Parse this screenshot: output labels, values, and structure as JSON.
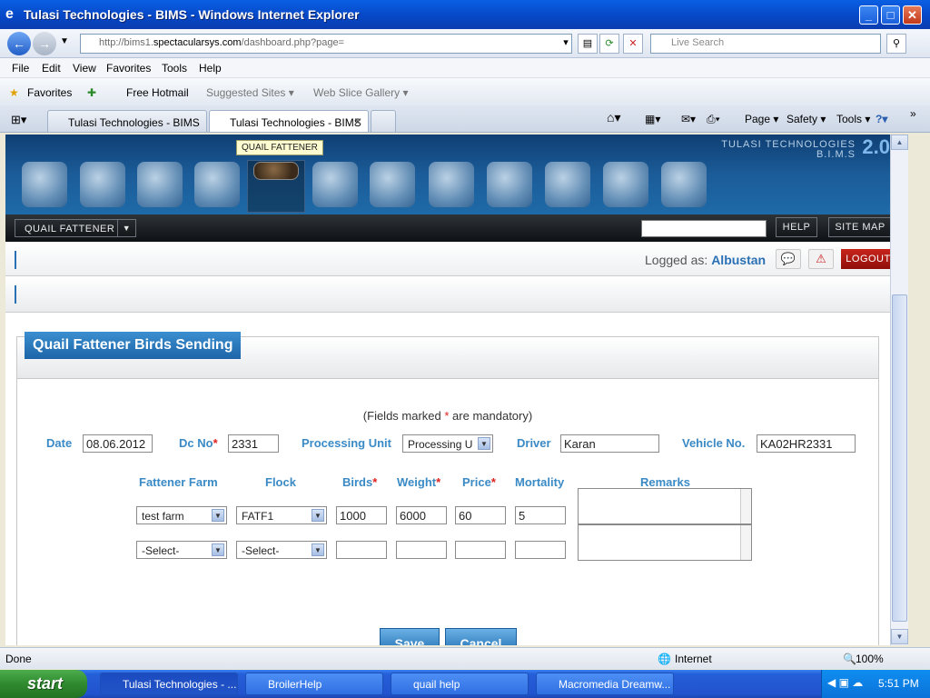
{
  "window": {
    "title": "Tulasi Technologies - BIMS - Windows Internet Explorer"
  },
  "browser": {
    "url_prefix": "http://bims1.",
    "url_domain": "spectacularsys.com",
    "url_path": "/dashboard.php?page=",
    "search_placeholder": "Live Search",
    "menu": [
      "File",
      "Edit",
      "View",
      "Favorites",
      "Tools",
      "Help"
    ],
    "favorites": {
      "label": "Favorites",
      "hotmail": "Free Hotmail",
      "suggested": "Suggested Sites ▾",
      "webslice": "Web Slice Gallery ▾"
    },
    "tabs": [
      "Tulasi Technologies - BIMS",
      "Tulasi Technologies - BIMS"
    ],
    "commands": {
      "page": "Page ▾",
      "safety": "Safety ▾",
      "tools": "Tools ▾"
    },
    "status": {
      "left": "Done",
      "zone": "Internet",
      "zoom": "100%"
    }
  },
  "app": {
    "brand": "TULASI TECHNOLOGIES",
    "brand_sub": "B.I.M.S",
    "version": "2.0",
    "tooltip": "QUAIL FATTENER",
    "nav_icons": [
      "home-icon",
      "broiler-icon",
      "quail-breeder-icon",
      "quail-chicks-icon",
      "quail-fattener-icon",
      "finance-icon",
      "store-icon",
      "inventory-icon",
      "orders-icon",
      "user-icon",
      "reports-icon",
      "info-icon"
    ],
    "module": "QUAIL FATTENER",
    "help": "HELP",
    "sitemap": "SITE MAP",
    "logged_label": "Logged as:",
    "user": "Albustan",
    "logout": "LOGOUT"
  },
  "form": {
    "title": "Quail Fattener Birds Sending",
    "mandatory_pre": "(Fields marked ",
    "mandatory_star": "*",
    "mandatory_post": " are mandatory)",
    "labels": {
      "date": "Date",
      "dcno": "Dc No",
      "unit": "Processing Unit",
      "driver": "Driver",
      "vehicle": "Vehicle No."
    },
    "values": {
      "date": "08.06.2012",
      "dcno": "2331",
      "unit": "Processing U",
      "driver": "Karan",
      "vehicle": "KA02HR2331"
    },
    "columns": {
      "farm": "Fattener Farm",
      "flock": "Flock",
      "birds": "Birds",
      "weight": "Weight",
      "price": "Price",
      "mortality": "Mortality",
      "remarks": "Remarks"
    },
    "rows": [
      {
        "farm": "test farm",
        "flock": "FATF1",
        "birds": "1000",
        "weight": "6000",
        "price": "60",
        "mortality": "5"
      },
      {
        "farm": "-Select-",
        "flock": "-Select-",
        "birds": "",
        "weight": "",
        "price": "",
        "mortality": ""
      }
    ],
    "save": "Save",
    "cancel": "Cancel"
  },
  "taskbar": {
    "start": "start",
    "items": [
      "Tulasi Technologies - ...",
      "BroilerHelp",
      "quail help",
      "Macromedia Dreamw..."
    ],
    "clock": "5:51 PM"
  }
}
